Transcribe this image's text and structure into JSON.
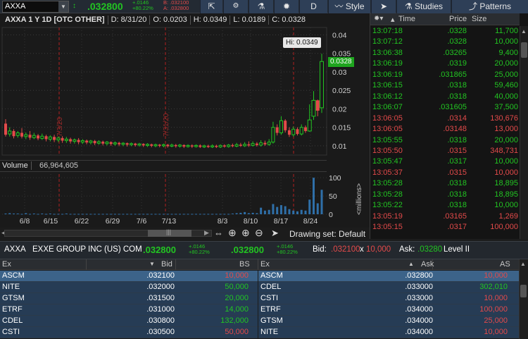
{
  "toolbar": {
    "symbol": "AXXA",
    "last": ".032800",
    "change": "+.0146",
    "change_pct": "+80.22%",
    "bid_line": "B: .032100",
    "ask_line": "A: .032800",
    "period_label": "D",
    "style_label": "Style",
    "studies_label": "Studies",
    "patterns_label": "Patterns"
  },
  "chart_header": {
    "title": "AXXA 1 Y 1D [OTC OTHER]",
    "date": "D: 8/31/20",
    "open": "O: 0.0203",
    "high": "H: 0.0349",
    "low": "L: 0.0189",
    "close": "C: 0.0328"
  },
  "chart_tags": {
    "hi": "Hi: 0.0349",
    "last": "0.0328"
  },
  "volume": {
    "label": "Volume",
    "value": "66,964,605",
    "unit": "<millions>"
  },
  "chart_footer": {
    "drawing_set": "Drawing set: Default"
  },
  "chart_data": {
    "type": "candlestick",
    "x_ticks": [
      "6/8",
      "6/15",
      "6/22",
      "6/29",
      "7/6",
      "7/13",
      "8/3",
      "8/10",
      "8/17",
      "8/24"
    ],
    "y_ticks": [
      "0.04",
      "0.035",
      "0.03",
      "0.025",
      "0.02",
      "0.015",
      "0.01"
    ],
    "ylim": [
      0.0075,
      0.042
    ],
    "vol_ticks": [
      "100",
      "50",
      "0"
    ],
    "vol_ylim": [
      0,
      110
    ],
    "event_markers": [
      "7/3/20",
      "7/31/20"
    ],
    "candles": [
      {
        "o": 0.016,
        "c": 0.013,
        "h": 0.0172,
        "l": 0.0125,
        "v": 2
      },
      {
        "o": 0.0132,
        "c": 0.014,
        "h": 0.015,
        "l": 0.0125,
        "v": 3
      },
      {
        "o": 0.014,
        "c": 0.0126,
        "h": 0.0145,
        "l": 0.012,
        "v": 2
      },
      {
        "o": 0.0128,
        "c": 0.0135,
        "h": 0.014,
        "l": 0.0122,
        "v": 2
      },
      {
        "o": 0.0135,
        "c": 0.0125,
        "h": 0.0148,
        "l": 0.012,
        "v": 1
      },
      {
        "o": 0.0125,
        "c": 0.013,
        "h": 0.0136,
        "l": 0.0118,
        "v": 3
      },
      {
        "o": 0.013,
        "c": 0.0122,
        "h": 0.014,
        "l": 0.0116,
        "v": 1
      },
      {
        "o": 0.0122,
        "c": 0.0128,
        "h": 0.0135,
        "l": 0.0118,
        "v": 2
      },
      {
        "o": 0.0128,
        "c": 0.012,
        "h": 0.0132,
        "l": 0.0115,
        "v": 1
      },
      {
        "o": 0.012,
        "c": 0.0126,
        "h": 0.0133,
        "l": 0.0116,
        "v": 2
      },
      {
        "o": 0.0126,
        "c": 0.0118,
        "h": 0.013,
        "l": 0.0112,
        "v": 1
      },
      {
        "o": 0.0118,
        "c": 0.0124,
        "h": 0.0128,
        "l": 0.0112,
        "v": 2
      },
      {
        "o": 0.0124,
        "c": 0.0116,
        "h": 0.013,
        "l": 0.011,
        "v": 1
      },
      {
        "o": 0.0116,
        "c": 0.0121,
        "h": 0.0125,
        "l": 0.011,
        "v": 1
      },
      {
        "o": 0.0121,
        "c": 0.0114,
        "h": 0.0126,
        "l": 0.0108,
        "v": 1
      },
      {
        "o": 0.0114,
        "c": 0.0118,
        "h": 0.0124,
        "l": 0.0108,
        "v": 2
      },
      {
        "o": 0.0118,
        "c": 0.0112,
        "h": 0.0122,
        "l": 0.0106,
        "v": 1
      },
      {
        "o": 0.0112,
        "c": 0.0116,
        "h": 0.012,
        "l": 0.0106,
        "v": 1
      },
      {
        "o": 0.0116,
        "c": 0.011,
        "h": 0.0121,
        "l": 0.0104,
        "v": 1
      },
      {
        "o": 0.011,
        "c": 0.0114,
        "h": 0.0118,
        "l": 0.0105,
        "v": 1
      },
      {
        "o": 0.0114,
        "c": 0.0109,
        "h": 0.0117,
        "l": 0.0104,
        "v": 1
      },
      {
        "o": 0.0109,
        "c": 0.0113,
        "h": 0.0116,
        "l": 0.0104,
        "v": 1
      },
      {
        "o": 0.0113,
        "c": 0.0107,
        "h": 0.0116,
        "l": 0.0102,
        "v": 1
      },
      {
        "o": 0.0107,
        "c": 0.0111,
        "h": 0.0115,
        "l": 0.0103,
        "v": 1
      },
      {
        "o": 0.0111,
        "c": 0.0106,
        "h": 0.0114,
        "l": 0.0101,
        "v": 1
      },
      {
        "o": 0.0106,
        "c": 0.011,
        "h": 0.0113,
        "l": 0.0101,
        "v": 1
      },
      {
        "o": 0.011,
        "c": 0.0105,
        "h": 0.0112,
        "l": 0.01,
        "v": 1
      },
      {
        "o": 0.0105,
        "c": 0.0108,
        "h": 0.0112,
        "l": 0.01,
        "v": 1
      },
      {
        "o": 0.0108,
        "c": 0.0104,
        "h": 0.0111,
        "l": 0.0099,
        "v": 1
      },
      {
        "o": 0.0104,
        "c": 0.0107,
        "h": 0.011,
        "l": 0.0099,
        "v": 1
      },
      {
        "o": 0.0107,
        "c": 0.0103,
        "h": 0.0109,
        "l": 0.0098,
        "v": 1
      },
      {
        "o": 0.0103,
        "c": 0.0106,
        "h": 0.0109,
        "l": 0.0099,
        "v": 1
      },
      {
        "o": 0.0106,
        "c": 0.0102,
        "h": 0.0108,
        "l": 0.0098,
        "v": 1
      },
      {
        "o": 0.0102,
        "c": 0.0105,
        "h": 0.0108,
        "l": 0.0098,
        "v": 1
      },
      {
        "o": 0.0105,
        "c": 0.0101,
        "h": 0.0107,
        "l": 0.0097,
        "v": 1
      },
      {
        "o": 0.0101,
        "c": 0.0104,
        "h": 0.0107,
        "l": 0.0097,
        "v": 1
      },
      {
        "o": 0.0104,
        "c": 0.01,
        "h": 0.0106,
        "l": 0.0096,
        "v": 1
      },
      {
        "o": 0.01,
        "c": 0.0103,
        "h": 0.0106,
        "l": 0.0096,
        "v": 1
      },
      {
        "o": 0.0103,
        "c": 0.01,
        "h": 0.0105,
        "l": 0.0096,
        "v": 1
      },
      {
        "o": 0.01,
        "c": 0.0103,
        "h": 0.0106,
        "l": 0.0096,
        "v": 1
      },
      {
        "o": 0.0103,
        "c": 0.0099,
        "h": 0.0105,
        "l": 0.0095,
        "v": 1
      },
      {
        "o": 0.0099,
        "c": 0.0102,
        "h": 0.0106,
        "l": 0.0096,
        "v": 1
      },
      {
        "o": 0.0102,
        "c": 0.0099,
        "h": 0.0105,
        "l": 0.0095,
        "v": 1
      },
      {
        "o": 0.0099,
        "c": 0.0102,
        "h": 0.0105,
        "l": 0.0095,
        "v": 1
      },
      {
        "o": 0.0102,
        "c": 0.0098,
        "h": 0.0104,
        "l": 0.0094,
        "v": 1
      },
      {
        "o": 0.0098,
        "c": 0.0101,
        "h": 0.0104,
        "l": 0.0095,
        "v": 1
      },
      {
        "o": 0.0101,
        "c": 0.0098,
        "h": 0.0104,
        "l": 0.0094,
        "v": 1
      },
      {
        "o": 0.0098,
        "c": 0.0101,
        "h": 0.0104,
        "l": 0.0095,
        "v": 1
      },
      {
        "o": 0.0101,
        "c": 0.0097,
        "h": 0.0104,
        "l": 0.0094,
        "v": 1
      },
      {
        "o": 0.0097,
        "c": 0.01,
        "h": 0.0103,
        "l": 0.0094,
        "v": 1
      },
      {
        "o": 0.01,
        "c": 0.0097,
        "h": 0.0103,
        "l": 0.0094,
        "v": 1
      },
      {
        "o": 0.0097,
        "c": 0.01,
        "h": 0.0104,
        "l": 0.0094,
        "v": 1
      },
      {
        "o": 0.01,
        "c": 0.0097,
        "h": 0.0103,
        "l": 0.0094,
        "v": 1
      },
      {
        "o": 0.0097,
        "c": 0.0101,
        "h": 0.0104,
        "l": 0.0094,
        "v": 1
      },
      {
        "o": 0.0101,
        "c": 0.0098,
        "h": 0.0104,
        "l": 0.0095,
        "v": 1
      },
      {
        "o": 0.0098,
        "c": 0.0102,
        "h": 0.0105,
        "l": 0.0095,
        "v": 1
      },
      {
        "o": 0.0102,
        "c": 0.0099,
        "h": 0.0106,
        "l": 0.0096,
        "v": 2
      },
      {
        "o": 0.0099,
        "c": 0.0103,
        "h": 0.0108,
        "l": 0.0096,
        "v": 3
      },
      {
        "o": 0.0103,
        "c": 0.01,
        "h": 0.0108,
        "l": 0.0097,
        "v": 4
      },
      {
        "o": 0.01,
        "c": 0.0104,
        "h": 0.011,
        "l": 0.0097,
        "v": 6
      },
      {
        "o": 0.0104,
        "c": 0.0101,
        "h": 0.0112,
        "l": 0.0097,
        "v": 3
      },
      {
        "o": 0.0101,
        "c": 0.0106,
        "h": 0.0112,
        "l": 0.0098,
        "v": 4
      },
      {
        "o": 0.0106,
        "c": 0.0102,
        "h": 0.011,
        "l": 0.0098,
        "v": 3
      },
      {
        "o": 0.0102,
        "c": 0.0108,
        "h": 0.0115,
        "l": 0.0098,
        "v": 18
      },
      {
        "o": 0.0108,
        "c": 0.0104,
        "h": 0.0114,
        "l": 0.01,
        "v": 10
      },
      {
        "o": 0.0104,
        "c": 0.011,
        "h": 0.0118,
        "l": 0.01,
        "v": 12
      },
      {
        "o": 0.011,
        "c": 0.015,
        "h": 0.0165,
        "l": 0.0106,
        "v": 28
      },
      {
        "o": 0.015,
        "c": 0.0135,
        "h": 0.0158,
        "l": 0.0128,
        "v": 20
      },
      {
        "o": 0.0135,
        "c": 0.0168,
        "h": 0.018,
        "l": 0.013,
        "v": 25
      },
      {
        "o": 0.0168,
        "c": 0.0142,
        "h": 0.0172,
        "l": 0.0136,
        "v": 22
      },
      {
        "o": 0.0142,
        "c": 0.013,
        "h": 0.015,
        "l": 0.0124,
        "v": 14
      },
      {
        "o": 0.013,
        "c": 0.0145,
        "h": 0.0152,
        "l": 0.0125,
        "v": 10
      },
      {
        "o": 0.0145,
        "c": 0.0132,
        "h": 0.015,
        "l": 0.0128,
        "v": 8
      },
      {
        "o": 0.0132,
        "c": 0.015,
        "h": 0.0158,
        "l": 0.0128,
        "v": 12
      },
      {
        "o": 0.015,
        "c": 0.014,
        "h": 0.0155,
        "l": 0.0135,
        "v": 10
      },
      {
        "o": 0.014,
        "c": 0.017,
        "h": 0.0212,
        "l": 0.0138,
        "v": 40
      },
      {
        "o": 0.018,
        "c": 0.0223,
        "h": 0.0248,
        "l": 0.017,
        "v": 100
      },
      {
        "o": 0.0223,
        "c": 0.0195,
        "h": 0.0225,
        "l": 0.018,
        "v": 30
      },
      {
        "o": 0.0203,
        "c": 0.0328,
        "h": 0.0349,
        "l": 0.0189,
        "v": 67
      }
    ]
  },
  "time_sales": {
    "header": {
      "time": "Time",
      "price": "Price",
      "size": "Size"
    },
    "rows": [
      {
        "time": "13:07:18",
        "price": ".0328",
        "size": "11,700",
        "dir": "up"
      },
      {
        "time": "13:07:12",
        "price": ".0328",
        "size": "10,000",
        "dir": "up"
      },
      {
        "time": "13:06:38",
        "price": ".03265",
        "size": "9,400",
        "dir": "up"
      },
      {
        "time": "13:06:19",
        "price": ".0319",
        "size": "20,000",
        "dir": "up"
      },
      {
        "time": "13:06:19",
        "price": ".031865",
        "size": "25,000",
        "dir": "up"
      },
      {
        "time": "13:06:15",
        "price": ".0318",
        "size": "59,460",
        "dir": "up"
      },
      {
        "time": "13:06:12",
        "price": ".0318",
        "size": "40,000",
        "dir": "up"
      },
      {
        "time": "13:06:07",
        "price": ".031605",
        "size": "37,500",
        "dir": "up"
      },
      {
        "time": "13:06:05",
        "price": ".0314",
        "size": "130,676",
        "dir": "down"
      },
      {
        "time": "13:06:05",
        "price": ".03148",
        "size": "13,000",
        "dir": "down"
      },
      {
        "time": "13:05:55",
        "price": ".0318",
        "size": "20,000",
        "dir": "up"
      },
      {
        "time": "13:05:50",
        "price": ".0315",
        "size": "348,731",
        "dir": "down"
      },
      {
        "time": "13:05:47",
        "price": ".0317",
        "size": "10,000",
        "dir": "up"
      },
      {
        "time": "13:05:37",
        "price": ".0315",
        "size": "10,000",
        "dir": "down"
      },
      {
        "time": "13:05:28",
        "price": ".0318",
        "size": "18,895",
        "dir": "up"
      },
      {
        "time": "13:05:28",
        "price": ".0318",
        "size": "18,895",
        "dir": "up"
      },
      {
        "time": "13:05:22",
        "price": ".0318",
        "size": "10,000",
        "dir": "up"
      },
      {
        "time": "13:05:19",
        "price": ".03165",
        "size": "1,269",
        "dir": "down"
      },
      {
        "time": "13:05:15",
        "price": ".0317",
        "size": "100,000",
        "dir": "down"
      }
    ]
  },
  "level2_bar": {
    "symbol": "AXXA",
    "company": "EXXE GROUP INC (US) COM",
    "last": ".032800",
    "change": "+.0146",
    "change_pct": "+80.22%",
    "last2": ".032800",
    "change2": "+.0146",
    "change_pct2": "+80.22%",
    "bid_label": "Bid:",
    "bid": ".032100",
    "x": "x",
    "bid_size": "10,000",
    "ask_label": "Ask:",
    "ask": ".03280",
    "level_label": "Level II"
  },
  "level2_bids": {
    "header": {
      "ex": "Ex",
      "bid": "Bid",
      "bs": "BS"
    },
    "rows": [
      {
        "ex": "ASCM",
        "price": ".032100",
        "size": "10,000",
        "size_color": "red"
      },
      {
        "ex": "NITE",
        "price": ".032000",
        "size": "50,000",
        "size_color": "green"
      },
      {
        "ex": "GTSM",
        "price": ".031500",
        "size": "20,000",
        "size_color": "green"
      },
      {
        "ex": "ETRF",
        "price": ".031000",
        "size": "14,000",
        "size_color": "green"
      },
      {
        "ex": "CDEL",
        "price": ".030800",
        "size": "132,000",
        "size_color": "green"
      },
      {
        "ex": "CSTI",
        "price": ".030500",
        "size": "50,000",
        "size_color": "red"
      }
    ]
  },
  "level2_asks": {
    "header": {
      "ex": "Ex",
      "ask": "Ask",
      "as": "AS"
    },
    "rows": [
      {
        "ex": "ASCM",
        "price": ".032800",
        "size": "10,000",
        "size_color": "red"
      },
      {
        "ex": "CDEL",
        "price": ".033000",
        "size": "302,010",
        "size_color": "green"
      },
      {
        "ex": "CSTI",
        "price": ".033000",
        "size": "10,000",
        "size_color": "red"
      },
      {
        "ex": "ETRF",
        "price": ".034000",
        "size": "100,000",
        "size_color": "red"
      },
      {
        "ex": "GTSM",
        "price": ".034000",
        "size": "25,000",
        "size_color": "red"
      },
      {
        "ex": "NITE",
        "price": ".034000",
        "size": "10,000",
        "size_color": "red"
      }
    ]
  },
  "colors": {
    "up": "#22c422",
    "down": "#e34a4a",
    "accent": "#2e3f57",
    "volume_bar": "#2f6fa8"
  }
}
